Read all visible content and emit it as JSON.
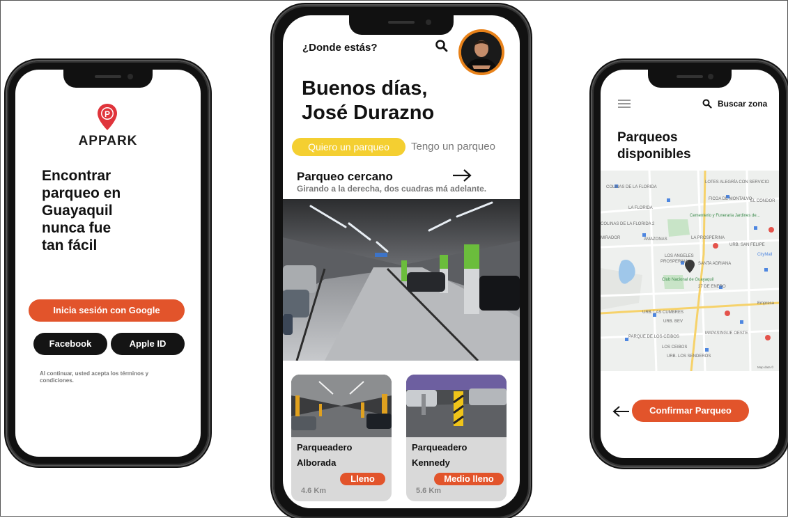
{
  "login": {
    "brand": "APPARK",
    "tagline_lines": [
      "Encontrar",
      "parqueo en",
      "Guayaquil",
      "nunca fue",
      "tan fácil"
    ],
    "google_button": "Inicia sesión con Google",
    "facebook_button": "Facebook",
    "apple_button": "Apple ID",
    "terms": "Al continuar, usted acepta los términos y condiciones."
  },
  "home": {
    "location_prompt": "¿Donde estás?",
    "greeting_line1": "Buenos días,",
    "greeting_line2": "José Durazno",
    "tabs": [
      {
        "label": "Quiero un parqueo",
        "active": true
      },
      {
        "label": "Tengo un parqueo",
        "active": false
      }
    ],
    "nearby_title": "Parqueo cercano",
    "nearby_directions": "Girando a la derecha, dos cuadras má adelante.",
    "cards": [
      {
        "name_line1": "Parqueadero",
        "name_line2": "Alborada",
        "status": "Lleno",
        "distance": "4.6 Km"
      },
      {
        "name_line1": "Parqueadero",
        "name_line2": "Kennedy",
        "status": "Medio lleno",
        "distance": "5.6 Km"
      }
    ]
  },
  "available": {
    "search_label": "Buscar zona",
    "title_line1": "Parqueos",
    "title_line2": "disponibles",
    "confirm_button": "Confirmar Parqueo",
    "map_labels": [
      "COLINAS DE LA FLORIDA",
      "LOTES ALEGRÍA CON SERVICIO",
      "FICOA DE MONTALVO",
      "EL CONDOR",
      "LA FLORIDA",
      "COLINAS DE LA FLORIDA 2",
      "MIRADOR",
      "AMAZONAS",
      "LA PROSPERINA",
      "URB. SAN FELIPE",
      "LOS ANGELES",
      "PROSPERINA",
      "SANTA ADRIANA",
      "27 DE ENERO",
      "URB. LAS CUMBRES",
      "URB. BEV",
      "MAPASINGUE OESTE",
      "PARQUE DE LOS CEIBOS",
      "LOS CEIBOS",
      "URB. LOS SENDEROS",
      "Club Nacional de Guayaquil",
      "Cementerio y Funeraria Jardines de...",
      "CityMall",
      "Empresa",
      "Map data ©"
    ]
  },
  "colors": {
    "accent": "#e2542b",
    "tab_active": "#f4cf31",
    "avatar_ring": "#e8821a",
    "card_bg": "#d9d9d9"
  },
  "icons": [
    "location-pin-icon",
    "search-icon",
    "arrow-right-icon",
    "arrow-left-icon",
    "menu-icon"
  ]
}
